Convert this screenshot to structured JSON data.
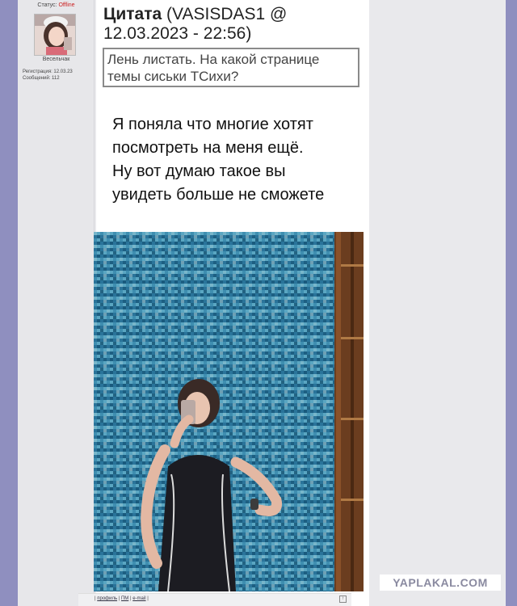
{
  "user": {
    "status_label": "Статус:",
    "status_value": "Offline",
    "rank": "Весельчак",
    "registration": "Регистрация: 12.03.23",
    "messages": "Сообщений: 112"
  },
  "quote": {
    "title": "Цитата",
    "author_date": "(VASISDAS1 @ 12.03.2023 - 22:56)",
    "text": "Лень листать. На какой странице темы сиськи ТСихи?"
  },
  "post": {
    "lines": [
      "Я поняла что многие хотят",
      "посмотреть на меня ещё.",
      "Ну вот думаю такое вы",
      "увидеть больше не сможете"
    ]
  },
  "footer": {
    "profile": "профиль",
    "pm": "ПМ",
    "email": "e-mail",
    "sep1": "|",
    "sep2": "|",
    "sep3": "|",
    "sep4": "|"
  },
  "watermark": "YAPLAKAL.COM",
  "colors": {
    "background": "#8f8fbf",
    "offline": "#cc2222",
    "tile_blue": "#3f8eb0"
  }
}
